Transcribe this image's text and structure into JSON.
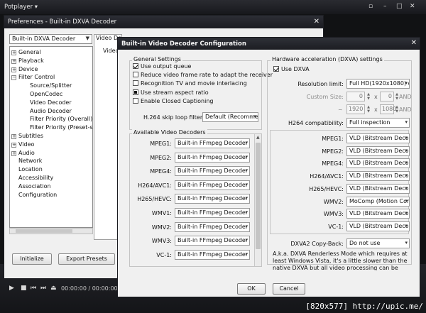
{
  "app": {
    "title": "Potplayer ▾",
    "time_readout": "00:00:00 / 00:00:00"
  },
  "watermark": "[820x577] http://upic.me/",
  "preferences": {
    "title": "Preferences - Built-in DXVA Decoder",
    "profile_select": "Built-in DXVA Decoder",
    "page_tab": "Video De",
    "page_sub": "Video",
    "tree": [
      {
        "label": "General",
        "indent": 0,
        "toggle": "+"
      },
      {
        "label": "Playback",
        "indent": 0,
        "toggle": "+"
      },
      {
        "label": "Device",
        "indent": 0,
        "toggle": "+"
      },
      {
        "label": "Filter Control",
        "indent": 0,
        "toggle": "-"
      },
      {
        "label": "Source/Splitter",
        "indent": 1,
        "toggle": ""
      },
      {
        "label": "OpenCodec",
        "indent": 1,
        "toggle": ""
      },
      {
        "label": "Video Decoder",
        "indent": 1,
        "toggle": ""
      },
      {
        "label": "Audio Decoder",
        "indent": 1,
        "toggle": ""
      },
      {
        "label": "Filter Priority (Overall)",
        "indent": 1,
        "toggle": ""
      },
      {
        "label": "Filter Priority (Preset-sp",
        "indent": 1,
        "toggle": ""
      },
      {
        "label": "Subtitles",
        "indent": 0,
        "toggle": "+"
      },
      {
        "label": "Video",
        "indent": 0,
        "toggle": "+"
      },
      {
        "label": "Audio",
        "indent": 0,
        "toggle": "+"
      },
      {
        "label": "Network",
        "indent": 0,
        "toggle": ""
      },
      {
        "label": "Location",
        "indent": 0,
        "toggle": ""
      },
      {
        "label": "Accessibility",
        "indent": 0,
        "toggle": ""
      },
      {
        "label": "Association",
        "indent": 0,
        "toggle": ""
      },
      {
        "label": "Configuration",
        "indent": 0,
        "toggle": ""
      }
    ],
    "initialize_button": "Initialize",
    "export_button": "Export Presets"
  },
  "dialog": {
    "title": "Built-in Video Decoder Configuration",
    "general_settings": {
      "title": "General Settings",
      "checkboxes": [
        {
          "label": "Use output queue",
          "state": "checked"
        },
        {
          "label": "Reduce video frame rate to adapt the receiver",
          "state": "unchecked"
        },
        {
          "label": "Recognition TV and movie interlacing",
          "state": "unchecked"
        },
        {
          "label": "Use stream aspect ratio",
          "state": "indeterminate"
        },
        {
          "label": "Enable Closed Captioning",
          "state": "unchecked"
        }
      ],
      "h264_skip_label": "H.264 skip loop filter:",
      "h264_skip_value": "Default (Recomme"
    },
    "available_decoders": {
      "title": "Available Video Decoders",
      "rows": [
        {
          "label": "MPEG1:",
          "value": "Built-in FFmpeg Decoder ("
        },
        {
          "label": "MPEG2:",
          "value": "Built-in FFmpeg Decoder ("
        },
        {
          "label": "MPEG4:",
          "value": "Built-in FFmpeg Decoder ("
        },
        {
          "label": "H264/AVC1:",
          "value": "Built-in FFmpeg Decoder ("
        },
        {
          "label": "H265/HEVC:",
          "value": "Built-in FFmpeg Decoder ("
        },
        {
          "label": "WMV1:",
          "value": "Built-in FFmpeg Decoder ("
        },
        {
          "label": "WMV2:",
          "value": "Built-in FFmpeg Decoder ("
        },
        {
          "label": "WMV3:",
          "value": "Built-in FFmpeg Decoder ("
        },
        {
          "label": "VC-1:",
          "value": "Built-in FFmpeg Decoder ("
        }
      ]
    },
    "dxva": {
      "title": "Hardware acceleration (DXVA) settings",
      "use_dxva_label": "Use DXVA",
      "resolution_label": "Resolution limit:",
      "resolution_value": "Full HD(1920x1080) or less",
      "custom_size_label": "Custom Size:",
      "custom_w": "0",
      "custom_h": "0",
      "and_label": "AND",
      "tilde_label": "~",
      "max_w": "1920",
      "max_h": "1080",
      "h264_compat_label": "H264 compatibility:",
      "h264_compat_value": "Full inspection",
      "rows": [
        {
          "label": "MPEG1:",
          "value": "VLD (Bitstream Decoding)"
        },
        {
          "label": "MPEG2:",
          "value": "VLD (Bitstream Decoding)"
        },
        {
          "label": "MPEG4:",
          "value": "VLD (Bitstream Decoding)"
        },
        {
          "label": "H264/AVC1:",
          "value": "VLD (Bitstream Decoding)"
        },
        {
          "label": "H265/HEVC:",
          "value": "VLD (Bitstream Decoding)"
        },
        {
          "label": "WMV2:",
          "value": "MoComp (Motion Compensat"
        },
        {
          "label": "WMV3:",
          "value": "VLD (Bitstream Decoding)"
        },
        {
          "label": "VC-1:",
          "value": "VLD (Bitstream Decoding)"
        }
      ],
      "copyback_label": "DXVA2 Copy-Back:",
      "copyback_value": "Do not use",
      "description": [
        "A.k.a. DXVA Renderless Mode which requires at",
        "least Windows Vista, it's a little slower than the",
        "native DXVA but all video processing can be used"
      ]
    },
    "ok_button": "OK",
    "cancel_button": "Cancel"
  }
}
